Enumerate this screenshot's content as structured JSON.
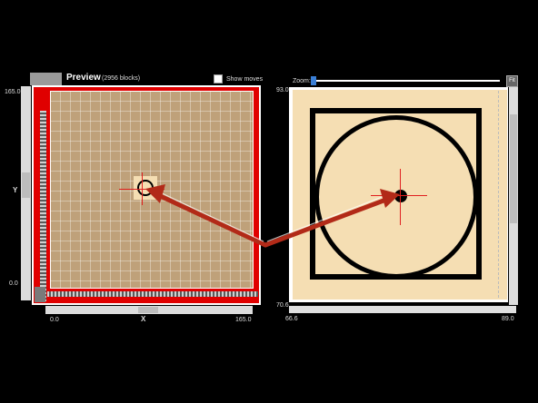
{
  "preview": {
    "title": "Preview",
    "blocks": "(2956 blocks)",
    "show_moves_label": "Show moves",
    "show_moves_checked": false,
    "y_max": "165.0",
    "y_min": "0.0",
    "y_axis_label": "Y",
    "x_min": "0.0",
    "x_max": "165.0",
    "x_axis_label": "X"
  },
  "zoom": {
    "label": "Zoom:",
    "fit_label": "Fit",
    "y_max": "93.0",
    "y_min": "70.6",
    "x_min": "66.6",
    "x_max": "89.0"
  },
  "colors": {
    "frame": "#e00000",
    "plate": "#bfa17a",
    "zoom_plate": "#f5deb3",
    "crosshair": "#e02020",
    "arrow": "#b22a18"
  }
}
